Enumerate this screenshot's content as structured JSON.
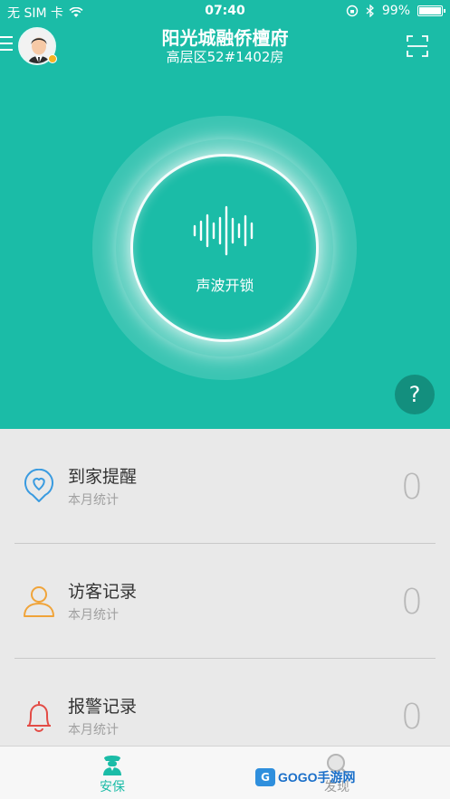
{
  "status_bar": {
    "carrier": "无 SIM 卡",
    "time": "07:40",
    "battery": "99%",
    "battery_level": 0.99
  },
  "header": {
    "title": "阳光城融侨檀府",
    "subtitle": "高层区52#1402房"
  },
  "unlock": {
    "label": "声波开锁"
  },
  "help": {
    "label": "?"
  },
  "records": [
    {
      "title": "到家提醒",
      "subtitle": "本月统计",
      "count": "0",
      "icon": "heart-location-icon",
      "color": "#3a9be0"
    },
    {
      "title": "访客记录",
      "subtitle": "本月统计",
      "count": "0",
      "icon": "person-icon",
      "color": "#f0a43a"
    },
    {
      "title": "报警记录",
      "subtitle": "本月统计",
      "count": "0",
      "icon": "bell-icon",
      "color": "#e34b45"
    }
  ],
  "tabs": [
    {
      "label": "安保",
      "active": true,
      "icon": "guard-icon"
    },
    {
      "label": "发现",
      "active": false,
      "icon": "discover-icon"
    }
  ],
  "watermark": {
    "text": "GOGO手游网"
  },
  "colors": {
    "primary": "#1bbca7",
    "help_button": "#138f7e"
  }
}
